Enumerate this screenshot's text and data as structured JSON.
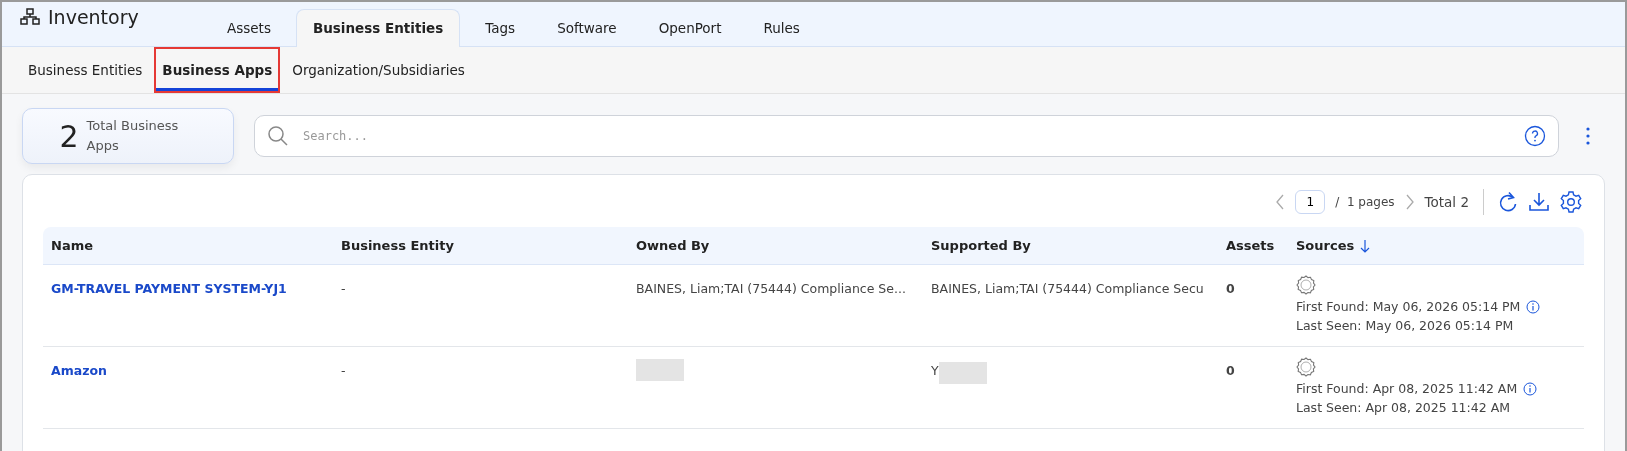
{
  "app": {
    "title": "Inventory"
  },
  "tabs": [
    {
      "label": "Assets",
      "selected": false
    },
    {
      "label": "Business Entities",
      "selected": true
    },
    {
      "label": "Tags",
      "selected": false
    },
    {
      "label": "Software",
      "selected": false
    },
    {
      "label": "OpenPort",
      "selected": false
    },
    {
      "label": "Rules",
      "selected": false
    }
  ],
  "subtabs": [
    {
      "label": "Business Entities",
      "selected": false,
      "highlighted": false
    },
    {
      "label": "Business Apps",
      "selected": true,
      "highlighted": true
    },
    {
      "label": "Organization/Subsidiaries",
      "selected": false,
      "highlighted": false
    }
  ],
  "summary": {
    "count": "2",
    "label": "Total Business Apps"
  },
  "search": {
    "placeholder": "Search..."
  },
  "pagination": {
    "page": "1",
    "pages": "/  1 pages",
    "total": "Total 2"
  },
  "table": {
    "columns": [
      {
        "label": "Name",
        "sorted": false
      },
      {
        "label": "Business Entity",
        "sorted": false
      },
      {
        "label": "Owned By",
        "sorted": false
      },
      {
        "label": "Supported By",
        "sorted": false
      },
      {
        "label": "Assets",
        "sorted": false
      },
      {
        "label": "Sources",
        "sorted": true
      }
    ],
    "rows": [
      {
        "name": "GM-TRAVEL PAYMENT SYSTEM-YJ1",
        "entity": "-",
        "owned_by": "BAINES, Liam;TAI (75444) Compliance Se...",
        "owned_redacted": false,
        "supported_by": "BAINES, Liam;TAI (75444) Compliance Secu",
        "supported_redacted": false,
        "assets": "0",
        "first_found": "First Found: May 06, 2026 05:14 PM",
        "last_seen": "Last Seen: May 06, 2026 05:14 PM"
      },
      {
        "name": "Amazon",
        "entity": "-",
        "owned_redacted": true,
        "supported_by": "Y",
        "supported_redacted": true,
        "assets": "0",
        "first_found": "First Found: Apr 08, 2025 11:42 AM",
        "last_seen": "Last Seen: Apr 08, 2025 11:42 AM"
      }
    ]
  }
}
